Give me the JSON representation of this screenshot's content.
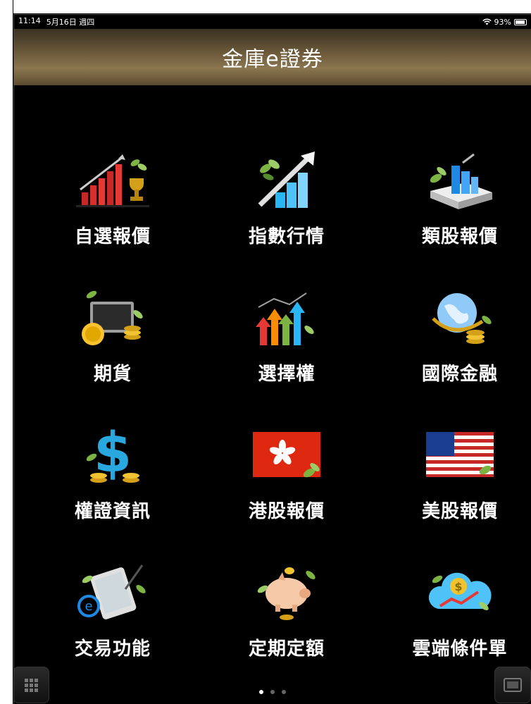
{
  "status_bar": {
    "time": "11:14",
    "date": "5月16日 週四",
    "battery": "93%",
    "battery_level": 0.93
  },
  "header": {
    "title": "金庫e證券"
  },
  "menu": [
    {
      "label": "自選報價",
      "icon": "rising-bar-chart-trophy-icon"
    },
    {
      "label": "指數行情",
      "icon": "rising-arrow-chart-icon"
    },
    {
      "label": "類股報價",
      "icon": "stacked-documents-chart-icon"
    },
    {
      "label": "期貨",
      "icon": "monitor-coins-icon"
    },
    {
      "label": "選擇權",
      "icon": "colored-arrows-chart-icon"
    },
    {
      "label": "國際金融",
      "icon": "globe-coins-icon"
    },
    {
      "label": "權證資訊",
      "icon": "dollar-sign-coins-icon"
    },
    {
      "label": "港股報價",
      "icon": "hong-kong-flag-icon"
    },
    {
      "label": "美股報價",
      "icon": "us-flag-icon"
    },
    {
      "label": "交易功能",
      "icon": "tablet-stylus-icon"
    },
    {
      "label": "定期定額",
      "icon": "piggy-bank-icon"
    },
    {
      "label": "雲端條件單",
      "icon": "cloud-dollar-icon"
    }
  ],
  "pagination": {
    "current": 1,
    "total": 3
  },
  "colors": {
    "header_gold": "#8a7650",
    "background": "#000000",
    "text": "#ffffff"
  }
}
